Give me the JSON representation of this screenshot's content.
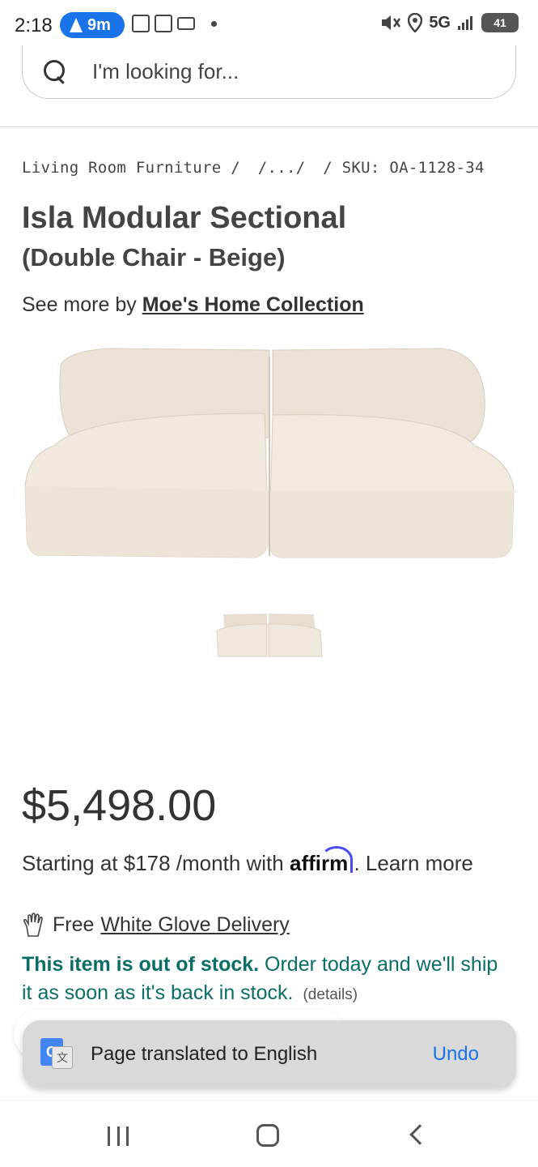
{
  "status_bar": {
    "time": "2:18",
    "nav_pill": "9m",
    "network": "5G",
    "battery": "41",
    "icons": [
      "nav-arrow-icon",
      "notification-icon",
      "box-icon",
      "mail-icon",
      "dot-icon",
      "mute-icon",
      "location-icon",
      "signal-icon",
      "battery-icon"
    ]
  },
  "search": {
    "placeholder": "I'm looking for..."
  },
  "breadcrumb": {
    "items": [
      "Living Room Furniture /",
      "/.../",
      "/ SKU: OA-1128-34"
    ]
  },
  "product": {
    "title": "Isla Modular Sectional",
    "subtitle": "(Double Chair - Beige)",
    "see_more_prefix": "See more by",
    "brand": "Moe's Home Collection",
    "price": "$5,498.00",
    "financing_prefix": "Starting at $178 /month with",
    "affirm": "affirm",
    "financing_suffix": ". Learn more",
    "delivery_prefix": "Free",
    "delivery_link": "White Glove Delivery",
    "stock_bold": "This item is out of stock.",
    "stock_text": " Order today and we'll ship it as soon as it's back in stock.",
    "details": "(details)",
    "colors": {
      "sofa": "#efe8dc",
      "sofa_shadow": "#ddd3c3",
      "stock": "#0a6e67"
    }
  },
  "toast": {
    "message": "Page translated to English",
    "action": "Undo",
    "icon": "google-translate-icon"
  },
  "system_nav": {
    "icons": [
      "recent-apps-icon",
      "home-icon",
      "back-icon"
    ]
  }
}
